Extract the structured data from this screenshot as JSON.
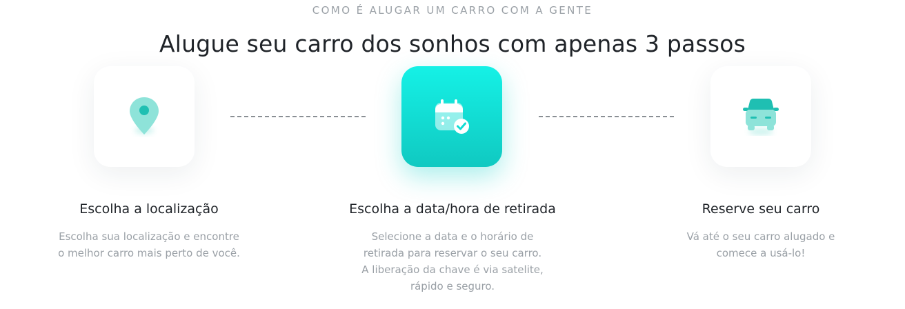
{
  "section": {
    "eyebrow": "COMO É ALUGAR UM CARRO COM A GENTE",
    "title": "Alugue seu carro dos sonhos com apenas 3 passos"
  },
  "steps": [
    {
      "icon": "location-pin-icon",
      "title": "Escolha a localização",
      "description": [
        "Escolha sua localização e encontre",
        "o melhor carro mais perto de você."
      ]
    },
    {
      "icon": "calendar-check-icon",
      "title": "Escolha a data/hora de retirada",
      "description": [
        "Selecione a data e o horário de",
        "retirada para reservar o seu carro.",
        "A liberação da chave é via satelite,",
        "rápido e seguro."
      ]
    },
    {
      "icon": "car-icon",
      "title": "Reserve seu carro",
      "description": [
        "Vá até o seu carro alugado e",
        "comece a usá-lo!"
      ]
    }
  ],
  "colors": {
    "accent": "#12DCD3",
    "icon_teal": "#1FBFB2",
    "icon_light": "#8EE3D9",
    "heading": "#1F2328",
    "muted": "#9AA0A6"
  }
}
